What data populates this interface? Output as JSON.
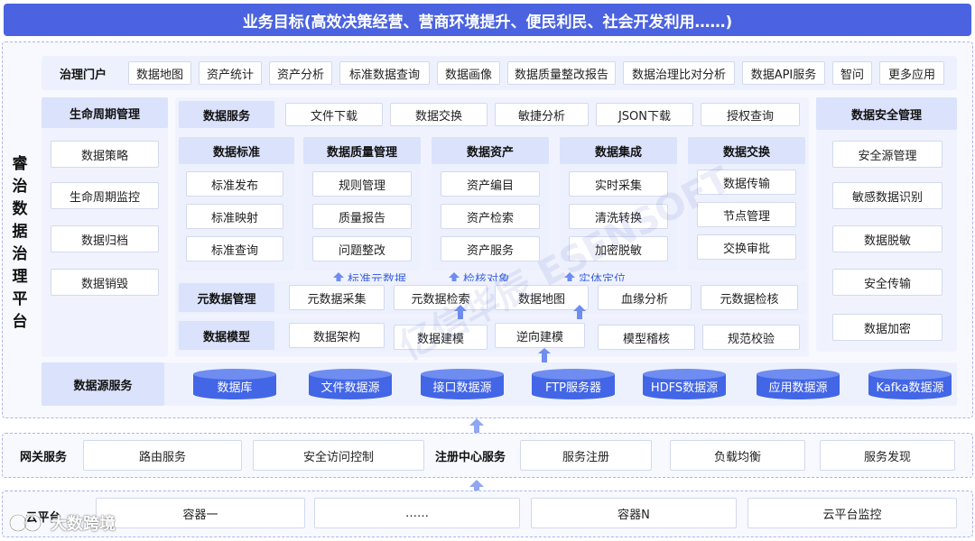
{
  "banner": "业务目标(高效决策经营、营商环境提升、便民利民、社会开发利用……)",
  "platform_title": [
    "睿",
    "治",
    "数",
    "据",
    "治",
    "理",
    "平",
    "台"
  ],
  "portal": {
    "label": "治理门户",
    "items": [
      "数据地图",
      "资产统计",
      "资产分析",
      "标准数据查询",
      "数据画像",
      "数据质量整改报告",
      "数据治理比对分析",
      "数据API服务",
      "智问",
      "更多应用"
    ]
  },
  "lifecycle": {
    "title": "生命周期管理",
    "items": [
      "数据策略",
      "生命周期监控",
      "数据归档",
      "数据销毁"
    ]
  },
  "data_service": {
    "label": "数据服务",
    "items": [
      "文件下载",
      "数据交换",
      "敏捷分析",
      "JSON下载",
      "授权查询"
    ]
  },
  "modules": [
    {
      "title": "数据标准",
      "items": [
        "标准发布",
        "标准映射",
        "标准查询"
      ]
    },
    {
      "title": "数据质量管理",
      "items": [
        "规则管理",
        "质量报告",
        "问题整改"
      ]
    },
    {
      "title": "数据资产",
      "items": [
        "资产编目",
        "资产检索",
        "资产服务"
      ]
    },
    {
      "title": "数据集成",
      "items": [
        "实时采集",
        "清洗转换",
        "加密脱敏"
      ]
    },
    {
      "title": "数据交换",
      "items": [
        "数据传输",
        "节点管理",
        "交换审批"
      ]
    }
  ],
  "arrow_notes": [
    "标准元数据",
    "检核对象",
    "实体定位"
  ],
  "metadata": {
    "label": "元数据管理",
    "items": [
      "元数据采集",
      "元数据检索",
      "数据地图",
      "血缘分析",
      "元数据检核"
    ]
  },
  "model": {
    "label": "数据模型",
    "items": [
      "数据架构",
      "数据建模",
      "逆向建模",
      "模型稽核",
      "规范校验"
    ]
  },
  "security": {
    "title": "数据安全管理",
    "items": [
      "安全源管理",
      "敏感数据识别",
      "数据脱敏",
      "安全传输",
      "数据加密"
    ]
  },
  "datasource": {
    "label": "数据源服务",
    "items": [
      "数据库",
      "文件数据源",
      "接口数据源",
      "FTP服务器",
      "HDFS数据源",
      "应用数据源",
      "Kafka数据源"
    ]
  },
  "gateway": {
    "label": "网关服务",
    "items": [
      "路由服务",
      "安全访问控制"
    ],
    "registry_label": "注册中心服务",
    "registry_items": [
      "服务注册",
      "负载均衡",
      "服务发现"
    ]
  },
  "cloud": {
    "label": "云平台",
    "items": [
      "容器一",
      "……",
      "容器N",
      "云平台监控"
    ]
  },
  "watermark": "亿信华辰 ESENSOFT",
  "footer_logo": "大数跨境",
  "colors": {
    "accent": "#4b63e0",
    "cylinder": "#4266e6",
    "arrow": "#6f8cf0"
  }
}
